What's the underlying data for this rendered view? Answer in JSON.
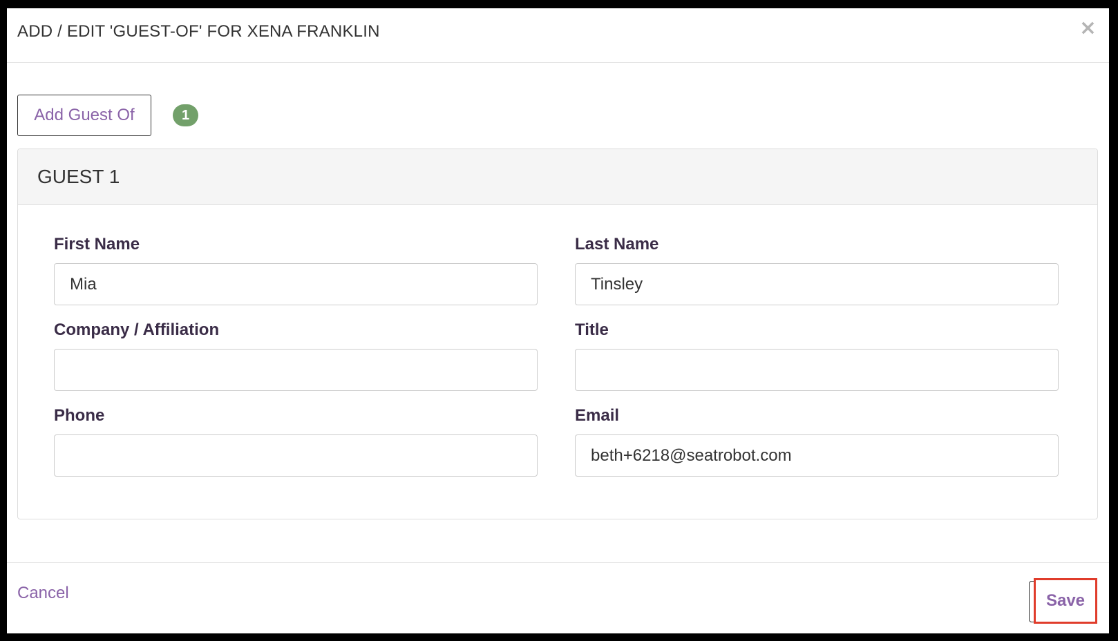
{
  "modal": {
    "title": "ADD / EDIT 'GUEST-OF' FOR XENA FRANKLIN",
    "close_glyph": "×",
    "close_icon": "close-icon"
  },
  "toolbar": {
    "add_guest_label": "Add Guest Of",
    "guest_count": "1"
  },
  "guest_panel": {
    "title": "GUEST 1",
    "fields": {
      "first_name": {
        "label": "First Name",
        "value": "Mia"
      },
      "last_name": {
        "label": "Last Name",
        "value": "Tinsley"
      },
      "company": {
        "label": "Company / Affiliation",
        "value": ""
      },
      "title": {
        "label": "Title",
        "value": ""
      },
      "phone": {
        "label": "Phone",
        "value": ""
      },
      "email": {
        "label": "Email",
        "value": "beth+6218@seatrobot.com"
      }
    }
  },
  "footer": {
    "cancel_label": "Cancel",
    "save_label": "Save"
  },
  "colors": {
    "accent": "#8a63a8",
    "badge": "#72a06a",
    "highlight": "#e03c2b"
  }
}
